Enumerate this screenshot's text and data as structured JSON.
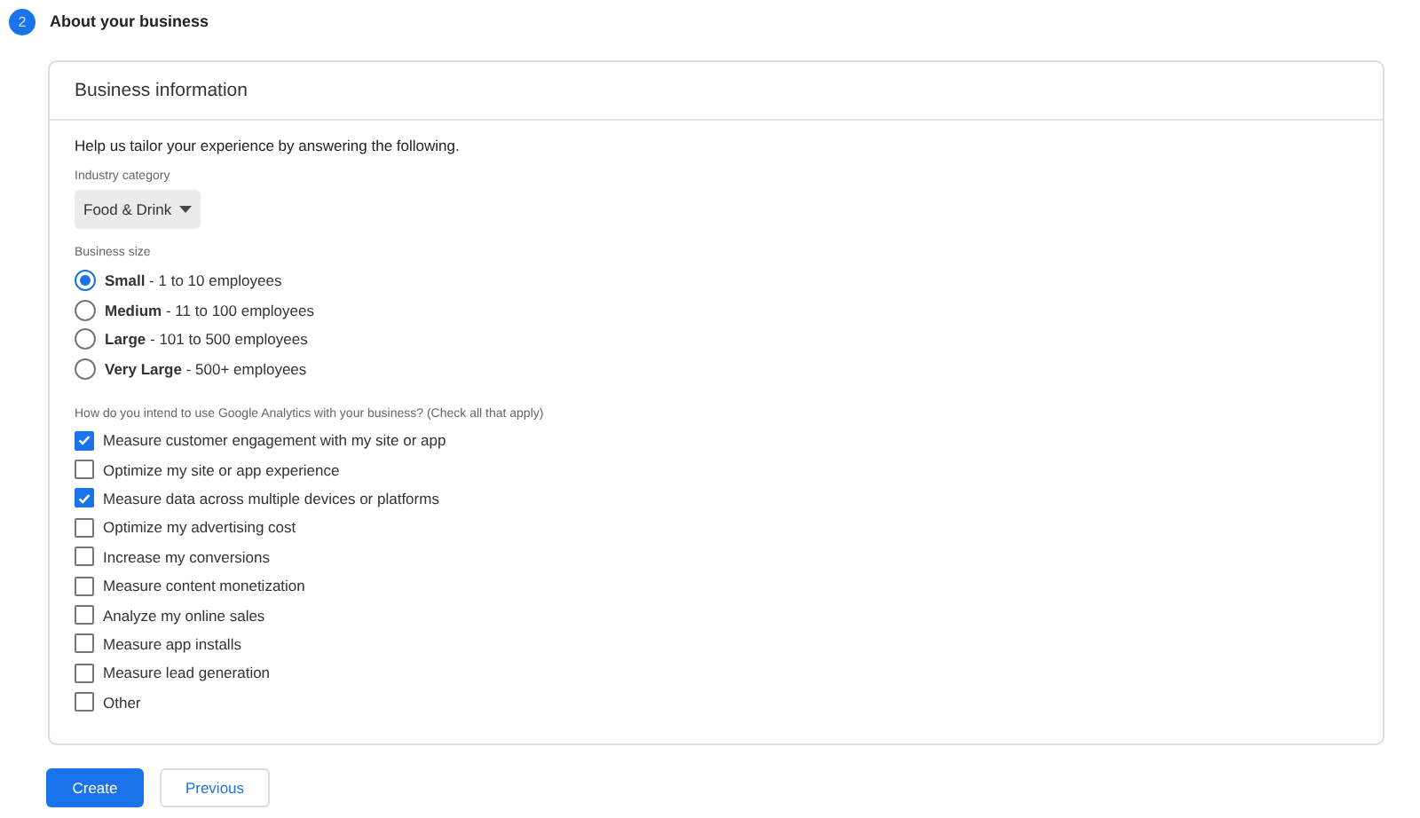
{
  "step": {
    "number": "2",
    "title": "About your business"
  },
  "card": {
    "title": "Business information",
    "intro": "Help us tailor your experience by answering the following."
  },
  "industry": {
    "label": "Industry category",
    "value": "Food & Drink"
  },
  "business_size": {
    "label": "Business size",
    "options": [
      {
        "text": "**Small** - 1 to 10 employees",
        "selected": true
      },
      {
        "text": "**Medium** - 11 to 100 employees",
        "selected": false
      },
      {
        "text": "**Large** - 101 to 500 employees",
        "selected": false
      },
      {
        "text": "**Very Large** - 500+ employees",
        "selected": false
      }
    ]
  },
  "usage": {
    "label": "How do you intend to use Google Analytics with your business? (Check all that apply)",
    "options": [
      {
        "text": "Measure customer engagement with my site or app",
        "checked": true
      },
      {
        "text": "Optimize my site or app experience",
        "checked": false
      },
      {
        "text": "Measure data across multiple devices or platforms",
        "checked": true
      },
      {
        "text": "Optimize my advertising cost",
        "checked": false
      },
      {
        "text": "Increase my conversions",
        "checked": false
      },
      {
        "text": "Measure content monetization",
        "checked": false
      },
      {
        "text": "Analyze my online sales",
        "checked": false
      },
      {
        "text": "Measure app installs",
        "checked": false
      },
      {
        "text": "Measure lead generation",
        "checked": false
      },
      {
        "text": "Other",
        "checked": false
      }
    ]
  },
  "buttons": {
    "primary": "Create",
    "secondary": "Previous"
  }
}
